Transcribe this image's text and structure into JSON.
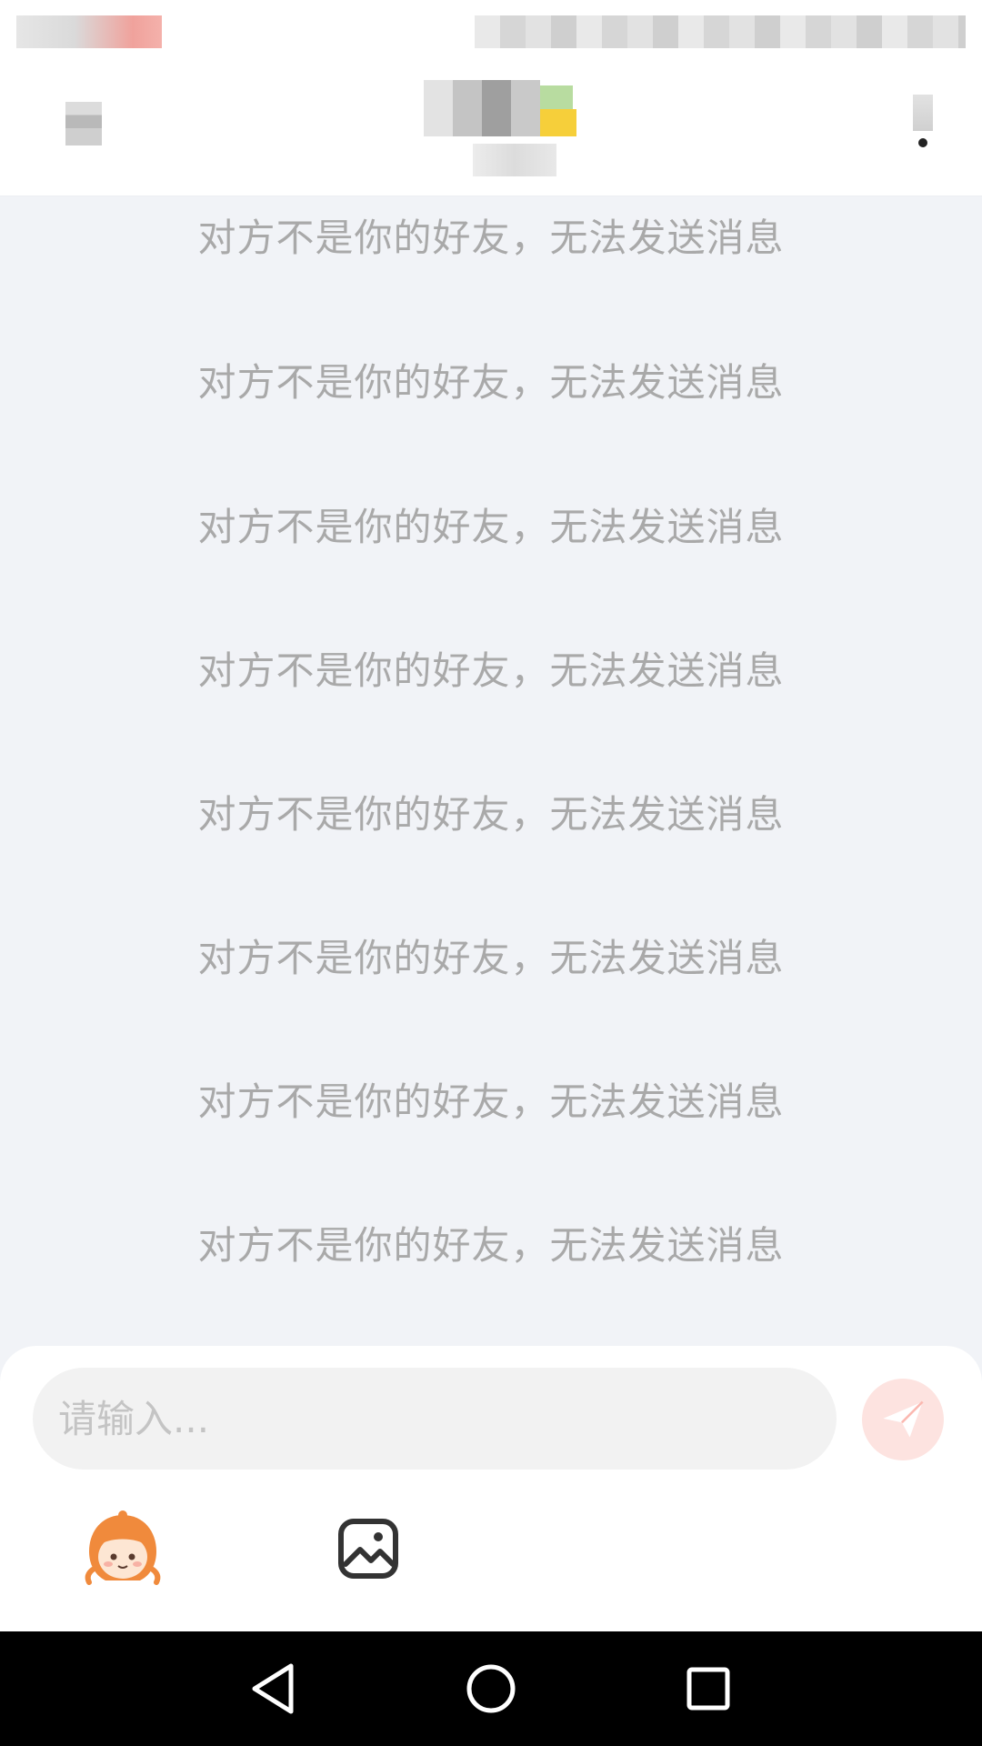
{
  "messages": [
    {
      "text": "对方不是你的好友，无法发送消息"
    },
    {
      "text": "对方不是你的好友，无法发送消息"
    },
    {
      "text": "对方不是你的好友，无法发送消息"
    },
    {
      "text": "对方不是你的好友，无法发送消息"
    },
    {
      "text": "对方不是你的好友，无法发送消息"
    },
    {
      "text": "对方不是你的好友，无法发送消息"
    },
    {
      "text": "对方不是你的好友，无法发送消息"
    },
    {
      "text": "对方不是你的好友，无法发送消息"
    }
  ],
  "input": {
    "placeholder": "请输入..."
  },
  "icons": {
    "back": "back-icon",
    "more": "more-icon",
    "send": "send-icon",
    "emoji": "emoji-icon",
    "image": "image-icon",
    "nav_back": "nav-back-icon",
    "nav_home": "nav-home-icon",
    "nav_recent": "nav-recent-icon"
  },
  "colors": {
    "chat_background": "#f1f3f7",
    "system_text": "#a9a9a9",
    "send_button": "#fde3e0",
    "send_icon": "#fbb8b0",
    "nav_bar": "#000000"
  }
}
